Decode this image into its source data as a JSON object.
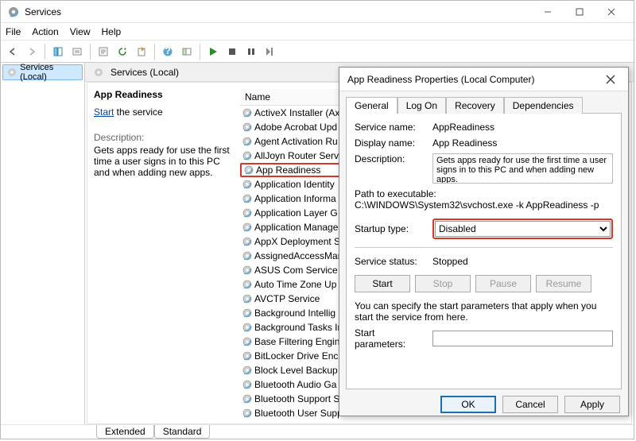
{
  "window": {
    "title": "Services",
    "menu": [
      "File",
      "Action",
      "View",
      "Help"
    ]
  },
  "tree": {
    "root": "Services (Local)"
  },
  "rightHeader": "Services (Local)",
  "detail": {
    "selectedName": "App Readiness",
    "startLink": "Start",
    "startSuffix": " the service",
    "descLabel": "Description:",
    "description": "Gets apps ready for use the first time a user signs in to this PC and when adding new apps."
  },
  "columns": {
    "name": "Name"
  },
  "services": [
    "ActiveX Installer (Ax",
    "Adobe Acrobat Upd",
    "Agent Activation Ru",
    "AllJoyn Router Servi",
    "App Readiness",
    "Application Identity",
    "Application Informa",
    "Application Layer G",
    "Application Manage",
    "AppX Deployment S",
    "AssignedAccessMan",
    "ASUS Com Service",
    "Auto Time Zone Up",
    "AVCTP Service",
    "Background Intellig",
    "Background Tasks In",
    "Base Filtering Engin",
    "BitLocker Drive Encr",
    "Block Level Backup",
    "Bluetooth Audio Ga",
    "Bluetooth Support S",
    "Bluetooth User Supp"
  ],
  "selectedIndex": 4,
  "footTabs": {
    "extended": "Extended",
    "standard": "Standard"
  },
  "dialog": {
    "title": "App Readiness Properties (Local Computer)",
    "tabs": {
      "general": "General",
      "logon": "Log On",
      "recovery": "Recovery",
      "deps": "Dependencies"
    },
    "labels": {
      "serviceName": "Service name:",
      "displayName": "Display name:",
      "description": "Description:",
      "pathLabel": "Path to executable:",
      "startupType": "Startup type:",
      "serviceStatus": "Service status:",
      "note": "You can specify the start parameters that apply when you start the service from here.",
      "startParams": "Start parameters:"
    },
    "values": {
      "serviceName": "AppReadiness",
      "displayName": "App Readiness",
      "description": "Gets apps ready for use the first time a user signs in to this PC and when adding new apps.",
      "path": "C:\\WINDOWS\\System32\\svchost.exe -k AppReadiness -p",
      "startupType": "Disabled",
      "serviceStatus": "Stopped",
      "startParams": ""
    },
    "buttons": {
      "start": "Start",
      "stop": "Stop",
      "pause": "Pause",
      "resume": "Resume",
      "ok": "OK",
      "cancel": "Cancel",
      "apply": "Apply"
    }
  }
}
